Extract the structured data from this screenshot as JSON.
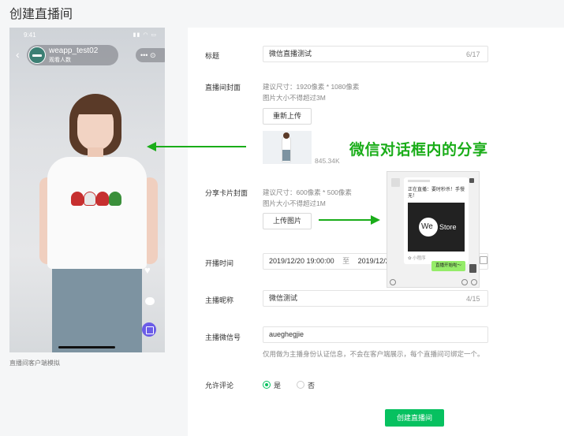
{
  "page": {
    "title": "创建直播间"
  },
  "phone": {
    "time": "9:41",
    "status_icons": "▮▮ ◠ ▭",
    "anchor_name": "weapp_test02",
    "viewers": "观看人数",
    "ops_text": "•••  ⊙",
    "caption": "直播间客户端模拟"
  },
  "form": {
    "title": {
      "label": "标题",
      "value": "微信直播测试",
      "counter": "6/17"
    },
    "cover": {
      "label": "直播间封面",
      "hint1": "建议尺寸：1920像素 * 1080像素",
      "hint2": "图片大小不得超过3M",
      "button": "重新上传",
      "size": "845.34K"
    },
    "share_card": {
      "label": "分享卡片封面",
      "hint1": "建议尺寸：600像素 * 500像素",
      "hint2": "图片大小不得超过1M",
      "button": "上传图片"
    },
    "start_time": {
      "label": "开播时间",
      "start": "2019/12/20 19:00:00",
      "separator": "至",
      "end": "2019/12/2"
    },
    "nickname": {
      "label": "主播昵称",
      "value": "微信测试",
      "counter": "4/15"
    },
    "wechat_id": {
      "label": "主播微信号",
      "value": "aueghegjie",
      "hint": "仅用做为主播身份认证信息，不会在客户端展示，每个直播间可绑定一个。"
    },
    "comments": {
      "label": "允许评论",
      "yes": "是",
      "no": "否"
    },
    "submit": "创建直播间"
  },
  "annotation": {
    "text": "微信对话框内的分享"
  },
  "chat_preview": {
    "message": "正在直播：要时秒杀！手慢无！",
    "logo_we": "We",
    "logo_store": "Store",
    "tag": "✿ 小程序",
    "reply": "直播开始啦～"
  },
  "colors": {
    "accent": "#07c160",
    "annotation": "#1aad19"
  }
}
